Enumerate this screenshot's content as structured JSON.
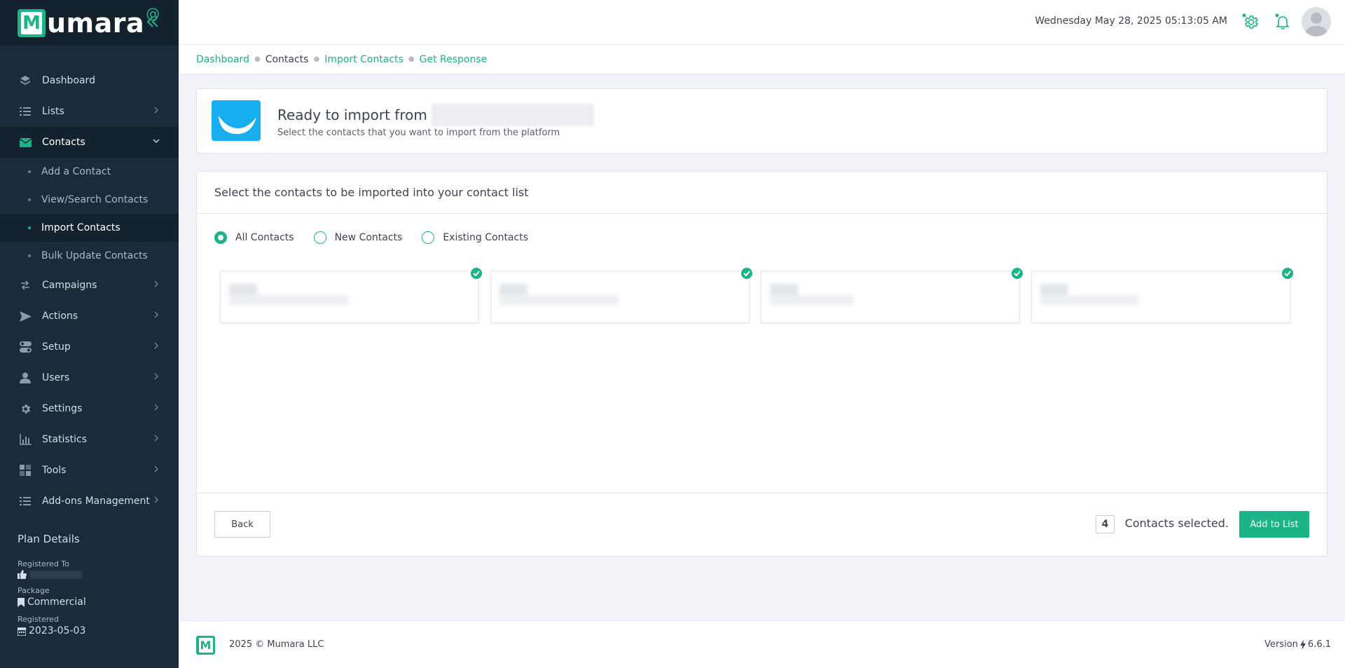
{
  "brand": {
    "name": "umara",
    "initial": "M",
    "at": "@"
  },
  "sidebar": {
    "items": [
      {
        "label": "Dashboard",
        "icon": "dashboard-icon"
      },
      {
        "label": "Lists",
        "icon": "list-icon"
      },
      {
        "label": "Contacts",
        "icon": "envelope-icon"
      },
      {
        "label": "Campaigns",
        "icon": "swap-icon"
      },
      {
        "label": "Actions",
        "icon": "send-icon"
      },
      {
        "label": "Setup",
        "icon": "toggle-icon"
      },
      {
        "label": "Users",
        "icon": "user-icon"
      },
      {
        "label": "Settings",
        "icon": "gear-icon"
      },
      {
        "label": "Statistics",
        "icon": "chart-icon"
      },
      {
        "label": "Tools",
        "icon": "grid-icon"
      },
      {
        "label": "Add-ons Management",
        "icon": "list-icon"
      }
    ],
    "contacts_sub": [
      {
        "label": "Add a Contact"
      },
      {
        "label": "View/Search Contacts"
      },
      {
        "label": "Import Contacts"
      },
      {
        "label": "Bulk Update Contacts"
      }
    ],
    "plan": {
      "title": "Plan Details",
      "registered_to_label": "Registered To",
      "package_label": "Package",
      "package_value": "Commercial",
      "registered_label": "Registered",
      "registered_value": "2023-05-03"
    }
  },
  "topbar": {
    "datetime": "Wednesday May 28, 2025 05:13:05 AM"
  },
  "breadcrumb": [
    "Dashboard",
    "Contacts",
    "Import Contacts",
    "Get Response"
  ],
  "import": {
    "title": "Ready to import from",
    "subtitle": "Select the contacts that you want to import from the platform"
  },
  "select": {
    "heading": "Select the contacts to be imported into your contact list",
    "radios": [
      "All Contacts",
      "New Contacts",
      "Existing Contacts"
    ],
    "selected_radio": "All Contacts"
  },
  "footer_bar": {
    "back_label": "Back",
    "count": "4",
    "count_label": "Contacts selected.",
    "add_label": "Add to List"
  },
  "footer": {
    "copyright": "2025 © Mumara LLC",
    "version_label": "Version",
    "version": "6.6.1"
  },
  "colors": {
    "accent": "#1bb486",
    "sidebar": "#1b2b3b",
    "sidebar_dark": "#142230",
    "getresponse_blue": "#16aef0"
  }
}
